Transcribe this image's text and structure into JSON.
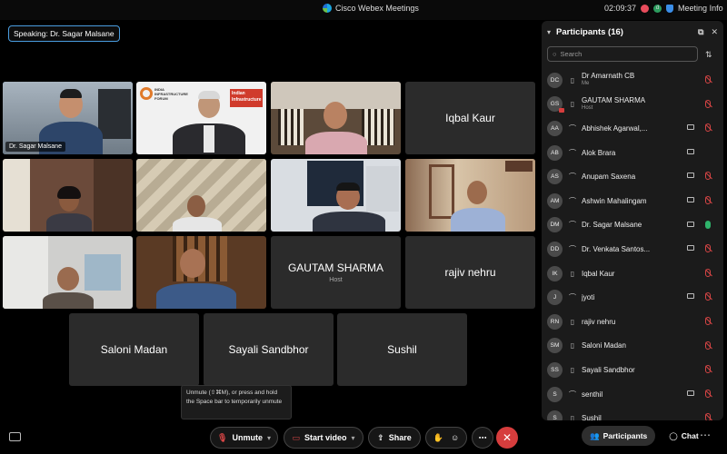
{
  "titlebar": {
    "app_title": "Cisco Webex Meetings",
    "timer": "02:09:37",
    "meeting_info": "Meeting Info",
    "badge_letter": "d"
  },
  "speaking_label": "Speaking:  Dr. Sagar Malsane",
  "video_tiles": [
    {
      "name": "Dr. Sagar Malsane"
    },
    {
      "name": ""
    },
    {
      "name": ""
    },
    {
      "name": ""
    },
    {
      "name": ""
    },
    {
      "name": ""
    },
    {
      "name": ""
    },
    {
      "name": ""
    },
    {
      "name": ""
    }
  ],
  "forum_logo": {
    "line1": "INDIA",
    "line2": "INFRASTRUCTURE",
    "line3": "FORUM",
    "banner1": "Indian",
    "banner2": "Infrastructure"
  },
  "name_tiles": [
    {
      "name": "Iqbal Kaur",
      "sub": ""
    },
    {
      "name": "GAUTAM SHARMA",
      "sub": "Host"
    },
    {
      "name": "rajiv nehru",
      "sub": ""
    },
    {
      "name": "Saloni Madan",
      "sub": ""
    },
    {
      "name": "Sayali Sandbhor",
      "sub": ""
    },
    {
      "name": "Sushil",
      "sub": ""
    }
  ],
  "tooltip": {
    "text": "Unmute (⇧⌘M), or press and hold the Space bar to temporarily unmute"
  },
  "toolbar": {
    "unmute": "Unmute",
    "start_video": "Start video",
    "share": "Share",
    "participants": "Participants",
    "chat": "Chat"
  },
  "panel": {
    "title": "Participants (16)",
    "search_placeholder": "Search"
  },
  "participants": [
    {
      "initials": "DC",
      "name": "Dr Amarnath CB",
      "role": "Me",
      "video": false,
      "mic": "muted"
    },
    {
      "initials": "GS",
      "name": "GAUTAM SHARMA",
      "role": "Host",
      "video": false,
      "mic": "muted"
    },
    {
      "initials": "AA",
      "name": "Abhishek Agarwal,...",
      "role": "",
      "video": true,
      "mic": "muted"
    },
    {
      "initials": "AB",
      "name": "Alok Brara",
      "role": "",
      "video": true,
      "mic": "none"
    },
    {
      "initials": "AS",
      "name": "Anupam Saxena",
      "role": "",
      "video": true,
      "mic": "muted"
    },
    {
      "initials": "AM",
      "name": "Ashwin Mahalingam",
      "role": "",
      "video": true,
      "mic": "muted"
    },
    {
      "initials": "DM",
      "name": "Dr. Sagar Malsane",
      "role": "",
      "video": true,
      "mic": "on"
    },
    {
      "initials": "DD",
      "name": "Dr. Venkata Santos...",
      "role": "",
      "video": true,
      "mic": "muted"
    },
    {
      "initials": "IK",
      "name": "Iqbal Kaur",
      "role": "",
      "video": false,
      "mic": "muted"
    },
    {
      "initials": "J",
      "name": "jyoti",
      "role": "",
      "video": true,
      "mic": "muted"
    },
    {
      "initials": "RN",
      "name": "rajiv nehru",
      "role": "",
      "video": false,
      "mic": "muted"
    },
    {
      "initials": "SM",
      "name": "Saloni Madan",
      "role": "",
      "video": false,
      "mic": "muted"
    },
    {
      "initials": "SS",
      "name": "Sayali Sandbhor",
      "role": "",
      "video": false,
      "mic": "muted"
    },
    {
      "initials": "S",
      "name": "senthil",
      "role": "",
      "video": true,
      "mic": "muted"
    },
    {
      "initials": "S",
      "name": "Sushil",
      "role": "",
      "video": false,
      "mic": "muted"
    }
  ],
  "colors": {
    "accent": "#5aa9e6",
    "end_call": "#d63d3d",
    "mic_on": "#2fb36b",
    "muted": "#d64545"
  }
}
